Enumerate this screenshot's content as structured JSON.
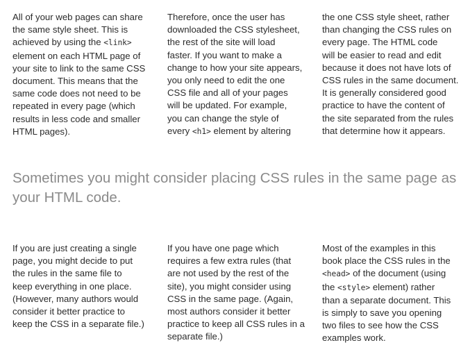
{
  "top_columns": [
    {
      "lines": [
        [
          {
            "t": "All of your web pages can share"
          }
        ],
        [
          {
            "t": "the same style sheet. This is"
          }
        ],
        [
          {
            "t": "achieved by using the "
          },
          {
            "t": "<link>",
            "code": true
          }
        ],
        [
          {
            "t": "element on each HTML page of"
          }
        ],
        [
          {
            "t": "your site to link to the same CSS"
          }
        ],
        [
          {
            "t": "document. This means that the"
          }
        ],
        [
          {
            "t": "same code does not need to be"
          }
        ],
        [
          {
            "t": "repeated in every page (which"
          }
        ],
        [
          {
            "t": "results in less code and smaller"
          }
        ],
        [
          {
            "t": "HTML pages)."
          }
        ]
      ]
    },
    {
      "lines": [
        [
          {
            "t": "Therefore, once the user has"
          }
        ],
        [
          {
            "t": "downloaded the CSS stylesheet,"
          }
        ],
        [
          {
            "t": "the rest of the site will load"
          }
        ],
        [
          {
            "t": "faster. If you want to make a"
          }
        ],
        [
          {
            "t": "change to how your site appears,"
          }
        ],
        [
          {
            "t": "you only need to edit the one"
          }
        ],
        [
          {
            "t": "CSS file and all of your pages"
          }
        ],
        [
          {
            "t": "will be updated. For example,"
          }
        ],
        [
          {
            "t": "you can change the style of"
          }
        ],
        [
          {
            "t": "every "
          },
          {
            "t": "<h1>",
            "code": true
          },
          {
            "t": " element by altering"
          }
        ]
      ]
    },
    {
      "lines": [
        [
          {
            "t": "the one CSS style sheet, rather"
          }
        ],
        [
          {
            "t": "than changing the CSS rules on"
          }
        ],
        [
          {
            "t": "every page. The HTML code"
          }
        ],
        [
          {
            "t": "will be easier to read and edit"
          }
        ],
        [
          {
            "t": "because it does not have lots of"
          }
        ],
        [
          {
            "t": "CSS rules in the same document."
          }
        ],
        [
          {
            "t": "It is generally considered good"
          }
        ],
        [
          {
            "t": "practice to have the content of"
          }
        ],
        [
          {
            "t": "the site separated from the rules"
          }
        ],
        [
          {
            "t": "that determine how it appears."
          }
        ]
      ]
    }
  ],
  "heading": {
    "line1": "Sometimes you might consider placing CSS rules in the same page as",
    "line2": "your HTML code."
  },
  "bottom_columns": [
    {
      "lines": [
        [
          {
            "t": "If you are just creating a single"
          }
        ],
        [
          {
            "t": "page, you might decide to put"
          }
        ],
        [
          {
            "t": "the rules in the same file to"
          }
        ],
        [
          {
            "t": "keep everything in one place."
          }
        ],
        [
          {
            "t": "(However, many authors would"
          }
        ],
        [
          {
            "t": "consider it better practice to"
          }
        ],
        [
          {
            "t": "keep the CSS in a separate file.)"
          }
        ]
      ]
    },
    {
      "lines": [
        [
          {
            "t": "If you have one page which"
          }
        ],
        [
          {
            "t": "requires a few extra rules (that"
          }
        ],
        [
          {
            "t": "are not used by the rest of the"
          }
        ],
        [
          {
            "t": "site), you might consider using"
          }
        ],
        [
          {
            "t": "CSS in the same page. (Again,"
          }
        ],
        [
          {
            "t": "most authors consider it better"
          }
        ],
        [
          {
            "t": "practice to keep all CSS rules in a"
          }
        ],
        [
          {
            "t": "separate file.)"
          }
        ]
      ]
    },
    {
      "lines": [
        [
          {
            "t": "Most of the examples in this"
          }
        ],
        [
          {
            "t": "book place the CSS rules in the"
          }
        ],
        [
          {
            "t": "<head>",
            "code": true
          },
          {
            "t": " of the document (using"
          }
        ],
        [
          {
            "t": "the "
          },
          {
            "t": "<style>",
            "code": true
          },
          {
            "t": " element) rather"
          }
        ],
        [
          {
            "t": "than a separate document. This"
          }
        ],
        [
          {
            "t": "is simply to save you opening"
          }
        ],
        [
          {
            "t": "two files to see how the CSS"
          }
        ],
        [
          {
            "t": "examples work."
          }
        ]
      ]
    }
  ]
}
